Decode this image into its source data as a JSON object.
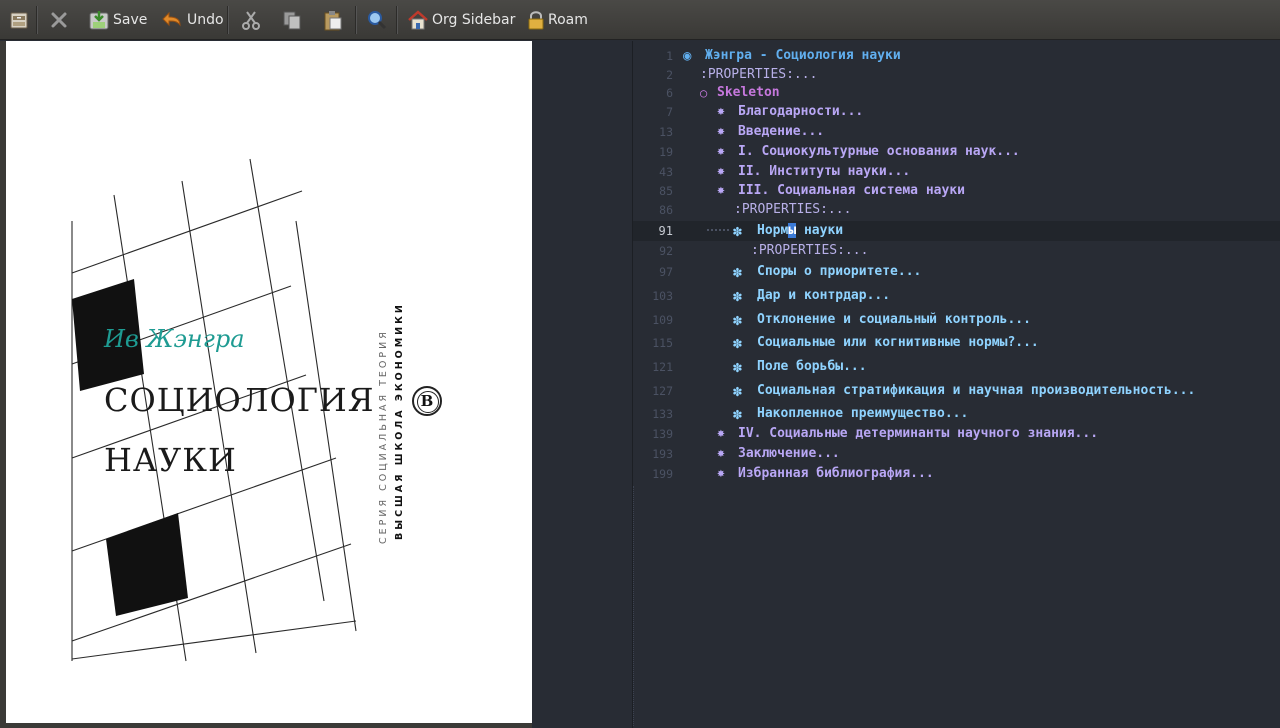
{
  "toolbar": {
    "items": [
      {
        "name": "new-file",
        "label": ""
      },
      {
        "name": "close",
        "label": ""
      },
      {
        "name": "save",
        "label": "Save"
      },
      {
        "name": "undo",
        "label": "Undo"
      },
      {
        "name": "cut",
        "label": ""
      },
      {
        "name": "copy",
        "label": ""
      },
      {
        "name": "paste",
        "label": ""
      },
      {
        "name": "search",
        "label": ""
      },
      {
        "name": "org-sidebar",
        "label": "Org Sidebar"
      },
      {
        "name": "roam",
        "label": "Roam"
      }
    ]
  },
  "cover": {
    "author": "Ив Жэнгра",
    "title_line1": "СОЦИОЛОГИЯ",
    "title_line2": "НАУКИ",
    "series": "СЕРИЯ СОЦИАЛЬНАЯ ТЕОРИЯ",
    "publisher": "ВЫСШАЯ ШКОЛА ЭКОНОМИКИ",
    "logo": "В"
  },
  "editor": {
    "current_line": "91",
    "lines": [
      {
        "num": "1",
        "text": "Жэнгра - Социология науки",
        "bullet": "◉",
        "kind": "lvl1"
      },
      {
        "num": "2",
        "text": ":PROPERTIES:...",
        "bullet": "",
        "kind": "prop"
      },
      {
        "num": "6",
        "text": "Skeleton",
        "bullet": "○",
        "kind": "lvl2"
      },
      {
        "num": "7",
        "text": "Благодарности...",
        "bullet": "✸",
        "kind": "lvl3"
      },
      {
        "num": "13",
        "text": "Введение...",
        "bullet": "✸",
        "kind": "lvl3"
      },
      {
        "num": "19",
        "text": "I. Социокультурные основания наук...",
        "bullet": "✸",
        "kind": "lvl3"
      },
      {
        "num": "43",
        "text": "II. Институты науки...",
        "bullet": "✸",
        "kind": "lvl3"
      },
      {
        "num": "85",
        "text": "III. Социальная система науки",
        "bullet": "✸",
        "kind": "lvl3"
      },
      {
        "num": "86",
        "text": ":PROPERTIES:...",
        "bullet": "",
        "kind": "prop"
      },
      {
        "num": "91",
        "text_before": "Норм",
        "text_cursor": "ы",
        "text_after": " науки",
        "bullet": "✽",
        "kind": "lvl4"
      },
      {
        "num": "92",
        "text": ":PROPERTIES:...",
        "bullet": "",
        "kind": "prop"
      },
      {
        "num": "97",
        "text": "Споры о приоритете...",
        "bullet": "✽",
        "kind": "lvl4"
      },
      {
        "num": "103",
        "text": "Дар и контрдар...",
        "bullet": "✽",
        "kind": "lvl4"
      },
      {
        "num": "109",
        "text": "Отклонение и социальный контроль...",
        "bullet": "✽",
        "kind": "lvl4"
      },
      {
        "num": "115",
        "text": "Социальные или когнитивные нормы?...",
        "bullet": "✽",
        "kind": "lvl4"
      },
      {
        "num": "121",
        "text": "Поле борьбы...",
        "bullet": "✽",
        "kind": "lvl4"
      },
      {
        "num": "127",
        "text": "Социальная стратификация и научная производительность...",
        "bullet": "✽",
        "kind": "lvl4"
      },
      {
        "num": "133",
        "text": "Накопленное преимущество...",
        "bullet": "✽",
        "kind": "lvl4"
      },
      {
        "num": "139",
        "text": "IV. Социальные детерминанты научного знания...",
        "bullet": "✸",
        "kind": "lvl3"
      },
      {
        "num": "193",
        "text": "Заключение...",
        "bullet": "✸",
        "kind": "lvl3"
      },
      {
        "num": "199",
        "text": "Избранная библиография...",
        "bullet": "✸",
        "kind": "lvl3"
      }
    ]
  }
}
